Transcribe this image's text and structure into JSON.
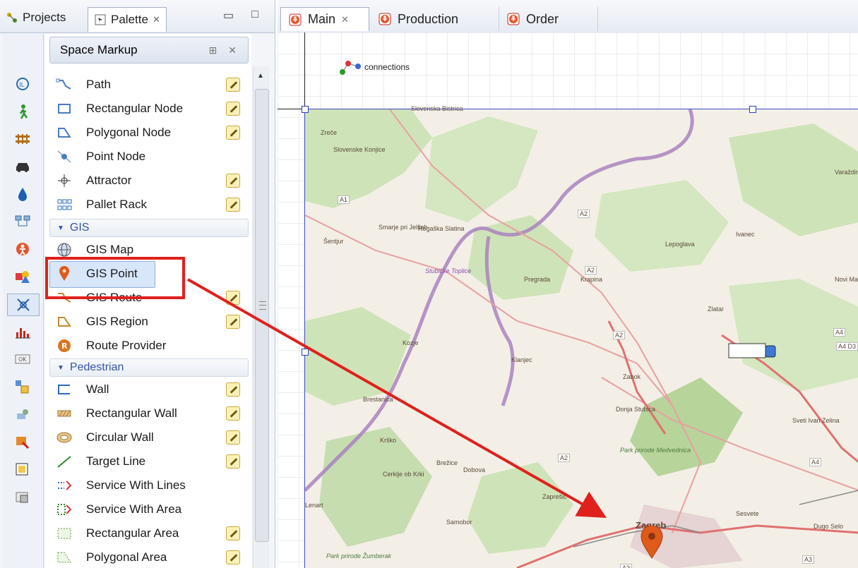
{
  "left_tabs": {
    "projects": "Projects",
    "palette": "Palette",
    "close": "✕"
  },
  "palette": {
    "header": "Space Markup",
    "items": [
      {
        "label": "Path",
        "editable": true
      },
      {
        "label": "Rectangular Node",
        "editable": true
      },
      {
        "label": "Polygonal Node",
        "editable": true
      },
      {
        "label": "Point Node",
        "editable": false
      },
      {
        "label": "Attractor",
        "editable": true
      },
      {
        "label": "Pallet Rack",
        "editable": true
      }
    ],
    "gis_group": "GIS",
    "gis_items": [
      {
        "label": "GIS Map",
        "editable": false
      },
      {
        "label": "GIS Point",
        "editable": false
      },
      {
        "label": "GIS Route",
        "editable": true
      },
      {
        "label": "GIS Region",
        "editable": true
      },
      {
        "label": "Route Provider",
        "editable": false
      }
    ],
    "ped_group": "Pedestrian",
    "ped_items": [
      {
        "label": "Wall",
        "editable": true
      },
      {
        "label": "Rectangular Wall",
        "editable": true
      },
      {
        "label": "Circular Wall",
        "editable": true
      },
      {
        "label": "Target Line",
        "editable": true
      },
      {
        "label": "Service With Lines",
        "editable": false
      },
      {
        "label": "Service With Area",
        "editable": false
      },
      {
        "label": "Rectangular Area",
        "editable": true
      },
      {
        "label": "Polygonal Area",
        "editable": true
      }
    ]
  },
  "editor_tabs": {
    "main": "Main",
    "production": "Production",
    "order": "Order"
  },
  "canvas": {
    "connections_label": "connections"
  },
  "map": {
    "places": [
      "Slovenska Bistrica",
      "Zreče",
      "Slovenske Konjice",
      "Smarje pri Jelšah",
      "Rogaška Slatina",
      "Šentjur",
      "Lepoglava",
      "Ivanec",
      "Varaždin",
      "Pregrada",
      "Krapina",
      "Zlatar",
      "Kozje",
      "Klanjec",
      "Zabok",
      "Brestanica",
      "Donja Stubica",
      "Krško",
      "Brežice",
      "Dobova",
      "Cerklje ob Krki",
      "Zaprešić",
      "Samobor",
      "Zagreb",
      "Sesvete",
      "Dugo Selo",
      "Sveti Ivan Zelina",
      "Novi Marof",
      "Park prirode Medvednica",
      "Park prirode Žumberak",
      "Lenart",
      "Stubičke Toplice"
    ],
    "roads": [
      "A1",
      "A2",
      "A2",
      "A2",
      "A2",
      "A4",
      "A4 D3",
      "A4",
      "A3",
      "A3"
    ]
  },
  "colors": {
    "accent": "#e0201c",
    "selection": "#d7e6f9",
    "pin": "#e05a1b"
  }
}
